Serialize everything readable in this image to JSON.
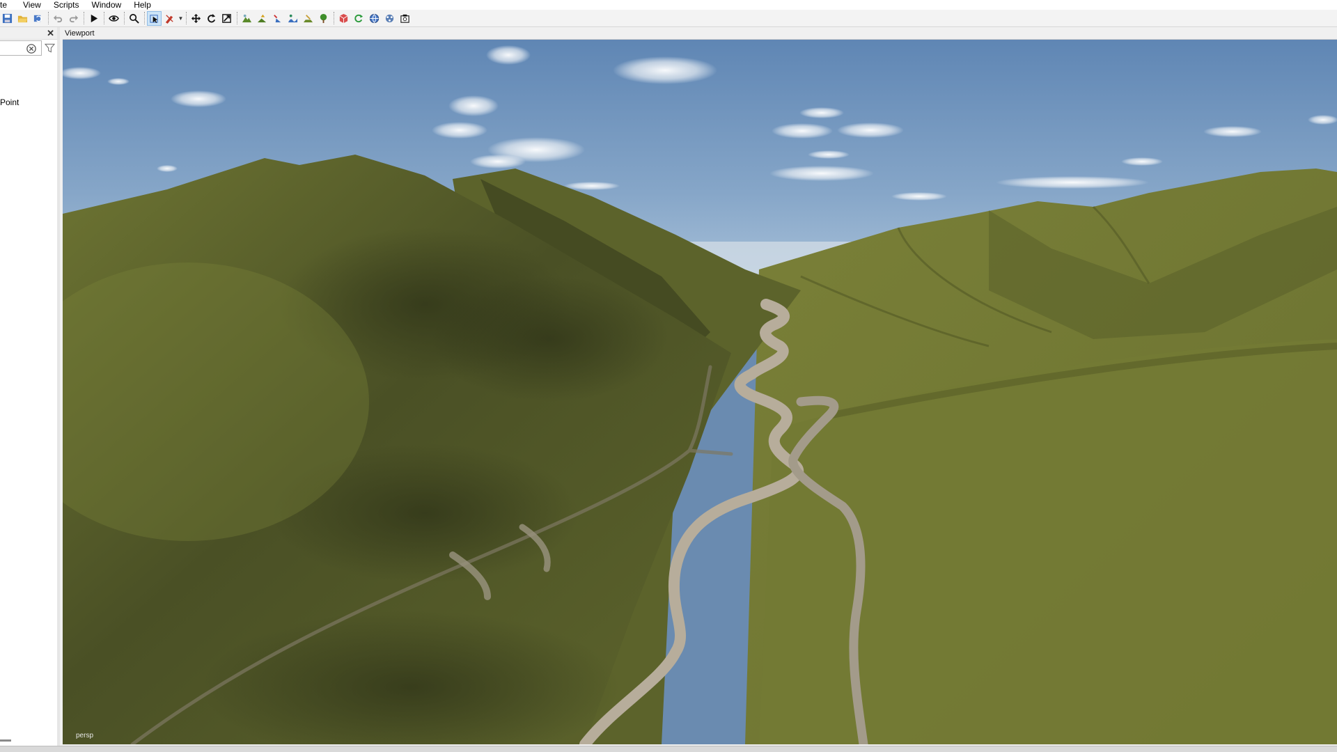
{
  "menubar": {
    "items": [
      "te",
      "View",
      "Scripts",
      "Window",
      "Help"
    ]
  },
  "toolbar": {
    "buttons": [
      "save-icon",
      "open-folder-icon",
      "reload-icon",
      "undo-icon",
      "redo-icon",
      "play-icon",
      "eye-icon",
      "search-icon",
      "select-icon",
      "paint-icon",
      "move-icon",
      "rotate-icon",
      "scale-icon",
      "terrain-tools-icons",
      "render-tools-icons"
    ]
  },
  "left_panel": {
    "item": "Point"
  },
  "viewport": {
    "title": "Viewport",
    "camera_label": "persp"
  },
  "colors": {
    "sky_top": "#5f86b4",
    "sky_bottom": "#a9c3dc",
    "grass": "#6d7431",
    "grass_dark": "#3f4520",
    "path": "#b7ad9b"
  }
}
